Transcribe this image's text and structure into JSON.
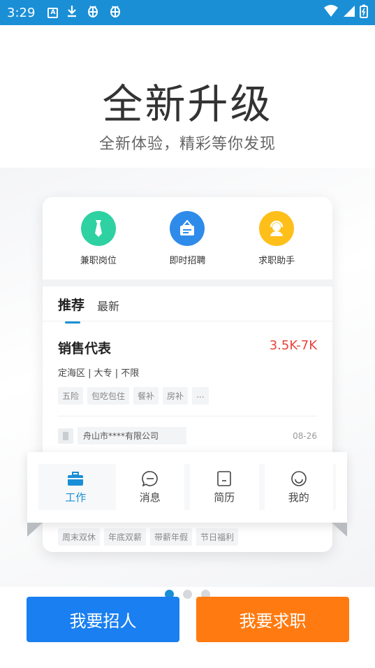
{
  "status_bar": {
    "time": "3:29",
    "icons": [
      "a-box-icon",
      "download-icon",
      "bug-icon",
      "bug-icon"
    ],
    "right_icons": [
      "wifi-icon",
      "signal-icon",
      "battery-icon"
    ]
  },
  "hero": {
    "title": "全新升级",
    "subtitle": "全新体验，精彩等你发现"
  },
  "quick_actions": [
    {
      "label": "兼职岗位",
      "icon": "tie-icon",
      "color": "#2ed1a2"
    },
    {
      "label": "即时招聘",
      "icon": "badge-icon",
      "color": "#2f8bea"
    },
    {
      "label": "求职助手",
      "icon": "assistant-icon",
      "color": "#ffbf1a"
    }
  ],
  "tabs": {
    "active": "推荐",
    "other": "最新"
  },
  "job": {
    "title": "销售代表",
    "salary": "3.5K-7K",
    "meta": "定海区 | 大专 | 不限",
    "tags": [
      "五险",
      "包吃包住",
      "餐补",
      "房补",
      "..."
    ],
    "company": "舟山市****有限公司",
    "date": "08-26"
  },
  "bottom_tags": [
    "周末双休",
    "年底双薪",
    "带薪年假",
    "节日福利"
  ],
  "nav": [
    {
      "label": "工作",
      "icon": "briefcase-icon",
      "active": true
    },
    {
      "label": "消息",
      "icon": "chat-icon",
      "active": false
    },
    {
      "label": "简历",
      "icon": "resume-icon",
      "active": false
    },
    {
      "label": "我的",
      "icon": "smile-icon",
      "active": false
    }
  ],
  "pager": {
    "count": 3,
    "active_index": 0
  },
  "buttons": {
    "hire": "我要招人",
    "seek": "我要求职"
  },
  "colors": {
    "brand_blue": "#1a7ff0",
    "brand_orange": "#ff7a10",
    "salary_red": "#e8453c"
  }
}
